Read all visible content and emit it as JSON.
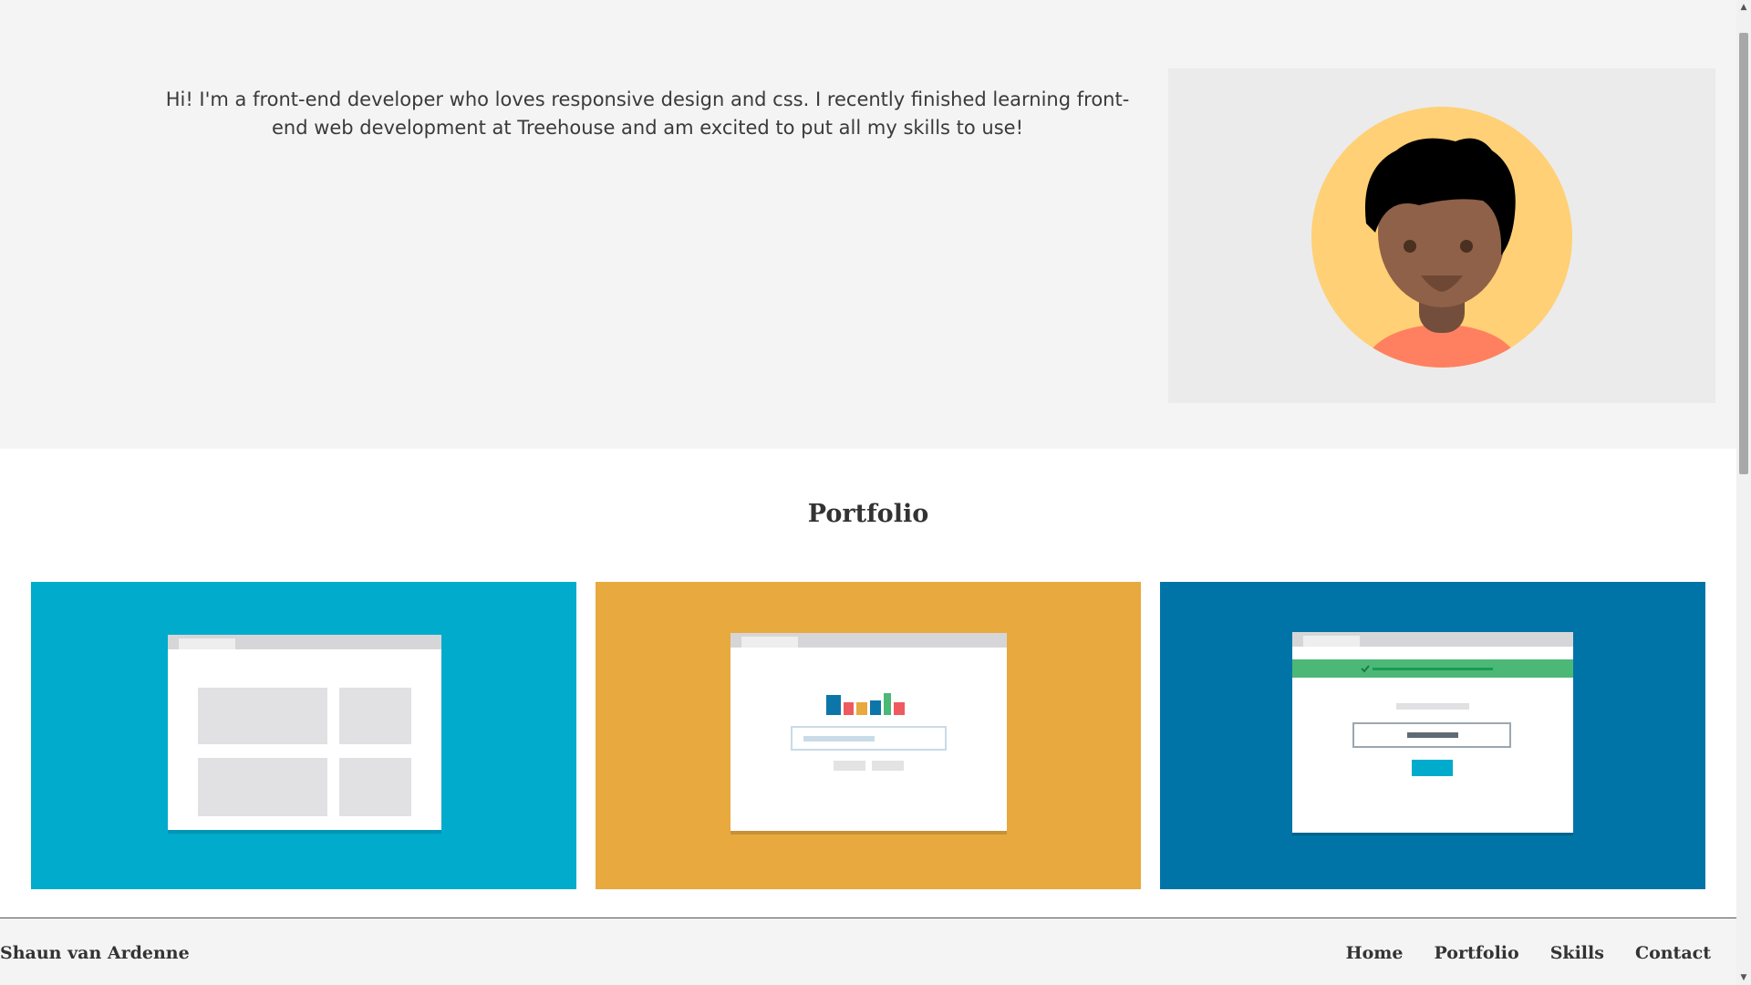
{
  "hero": {
    "intro": "Hi! I'm a front-end developer who loves responsive design and css. I recently finished learning front-end web development at Treehouse and am excited to put all my skills to use!",
    "avatar_icon": "avatar-illustration"
  },
  "portfolio": {
    "title": "Portfolio",
    "cards": [
      {
        "icon": "layout-mockup-icon",
        "color": "#00abcc"
      },
      {
        "icon": "chart-form-mockup-icon",
        "color": "#e8a93e"
      },
      {
        "icon": "login-form-mockup-icon",
        "color": "#0074a6"
      }
    ]
  },
  "footer": {
    "brand": "Shaun van Ardenne",
    "nav": [
      "Home",
      "Portfolio",
      "Skills",
      "Contact"
    ]
  },
  "colors": {
    "hero_bg": "#f4f4f4",
    "avatar_bg": "#ffd075",
    "skin": "#8f6148",
    "shirt": "#ff8060"
  }
}
